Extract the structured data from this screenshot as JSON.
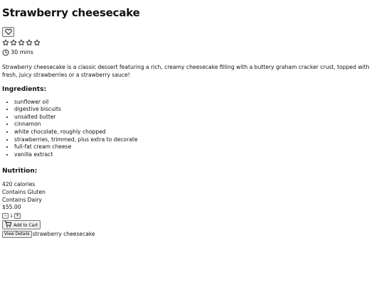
{
  "recipe": {
    "title": "Strawberry cheesecake",
    "rating_stars": 5,
    "rating_value": 0,
    "time": "30 mins",
    "description": "Strawberry cheesecake is a classic dessert featuring a rich, creamy cheesecake filling with a buttery graham cracker crust, topped with fresh, juicy strawberries or a strawberry sauce!",
    "ingredients_heading": "Ingredients:",
    "ingredients": [
      "sunflower oil",
      "digestive biscuits",
      "unsalted butter",
      "cinnamon",
      "white chocolate, roughly chopped",
      "strawberries, trimmed, plus extra to decorate",
      "full-fat cream cheese",
      "vanilla extract"
    ],
    "nutrition_heading": "Nutrition:",
    "nutrition": [
      "420 calories",
      "Contains Gluten",
      "Contains Dairy"
    ],
    "price": "$55.00"
  },
  "cart": {
    "decrement_label": "-",
    "quantity": "1",
    "increment_label": "+",
    "add_label": "Add to Cart"
  },
  "footer": {
    "view_details_label": "View Details",
    "item_title": "strawberry cheesecake"
  },
  "icons": {
    "favorite": "heart-outline-icon",
    "star": "star-outline-icon",
    "time": "clock-icon",
    "cart": "cart-icon"
  }
}
